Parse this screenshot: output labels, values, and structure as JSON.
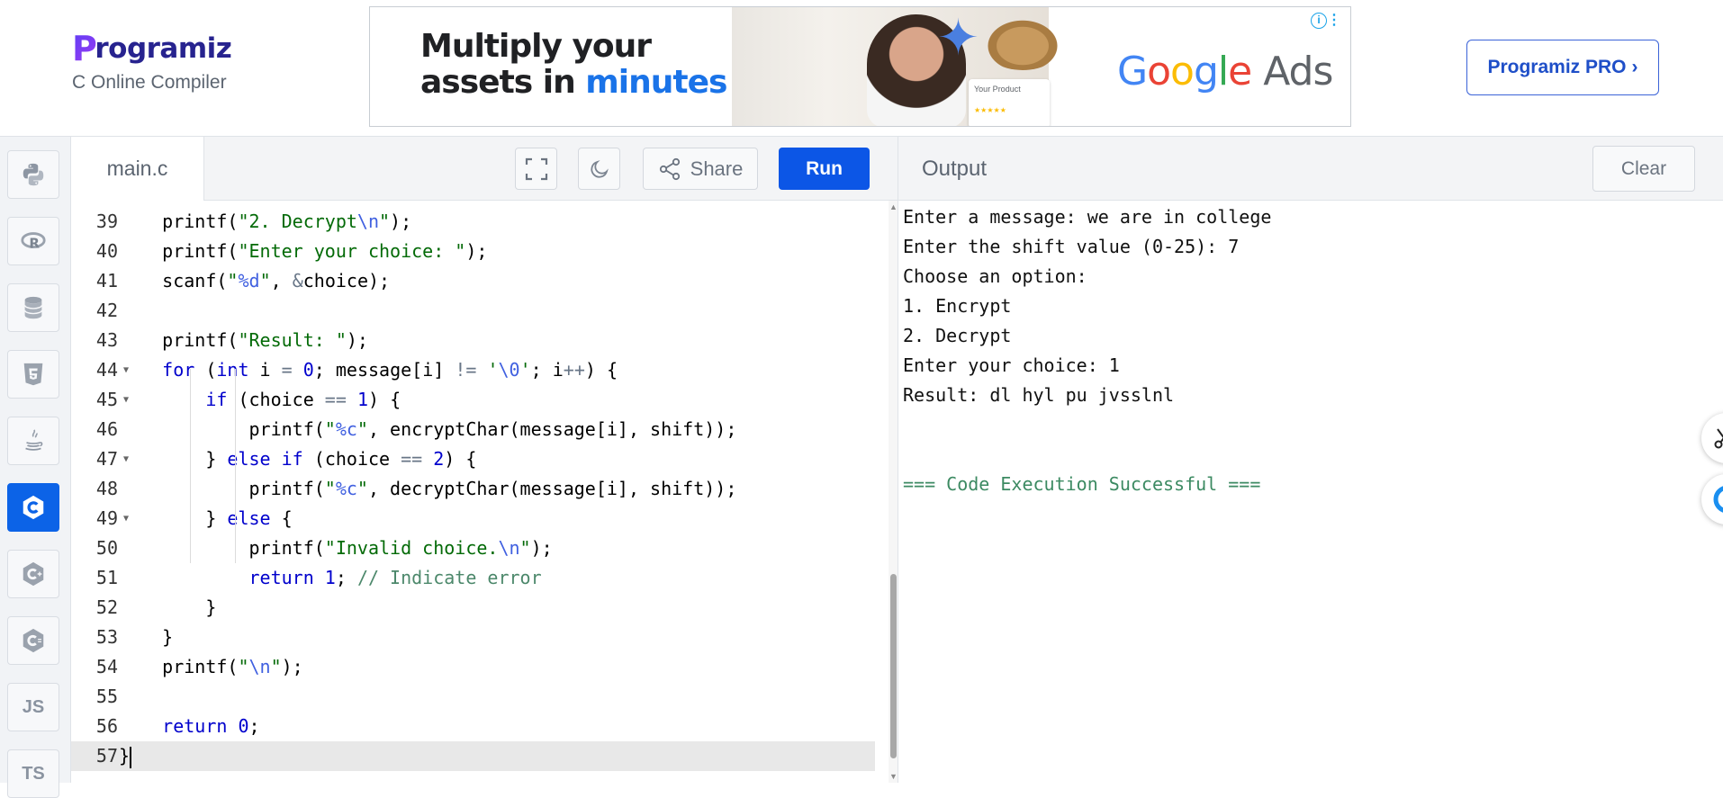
{
  "brand": {
    "name": "rogramiz",
    "subtitle": "C Online Compiler"
  },
  "ad": {
    "headline_line1": "Multiply your",
    "headline_line2_prefix": "assets in ",
    "headline_line2_highlight": "minutes",
    "product_card": "Your Product",
    "google": [
      "G",
      "o",
      "o",
      "g",
      "l",
      "e"
    ],
    "google_ads_word": "Ads",
    "info_icon": "info-icon"
  },
  "header": {
    "pro_button": "Programiz PRO",
    "pro_chevron": "›"
  },
  "sidebar": {
    "languages": [
      {
        "id": "python",
        "icon": "python-icon"
      },
      {
        "id": "r",
        "icon": "r-icon"
      },
      {
        "id": "sql",
        "icon": "database-icon"
      },
      {
        "id": "html",
        "icon": "html5-icon"
      },
      {
        "id": "java",
        "icon": "java-icon"
      },
      {
        "id": "c",
        "icon": "c-icon",
        "active": true
      },
      {
        "id": "cpp",
        "icon": "cpp-icon"
      },
      {
        "id": "csharp",
        "icon": "csharp-icon"
      },
      {
        "id": "js",
        "label": "JS"
      },
      {
        "id": "ts",
        "label": "TS"
      }
    ]
  },
  "editor": {
    "tab": "main.c",
    "share_label": "Share",
    "run_label": "Run",
    "lines": [
      {
        "n": 39,
        "text": "    printf(\"2. Decrypt\\n\");"
      },
      {
        "n": 40,
        "text": "    printf(\"Enter your choice: \");"
      },
      {
        "n": 41,
        "text": "    scanf(\"%d\", &choice);"
      },
      {
        "n": 42,
        "text": ""
      },
      {
        "n": 43,
        "text": "    printf(\"Result: \");"
      },
      {
        "n": 44,
        "text": "    for (int i = 0; message[i] != '\\0'; i++) {",
        "fold": true
      },
      {
        "n": 45,
        "text": "        if (choice == 1) {",
        "fold": true
      },
      {
        "n": 46,
        "text": "            printf(\"%c\", encryptChar(message[i], shift));"
      },
      {
        "n": 47,
        "text": "        } else if (choice == 2) {",
        "fold": true
      },
      {
        "n": 48,
        "text": "            printf(\"%c\", decryptChar(message[i], shift));"
      },
      {
        "n": 49,
        "text": "        } else {",
        "fold": true
      },
      {
        "n": 50,
        "text": "            printf(\"Invalid choice.\\n\");"
      },
      {
        "n": 51,
        "text": "            return 1; // Indicate error"
      },
      {
        "n": 52,
        "text": "        }"
      },
      {
        "n": 53,
        "text": "    }"
      },
      {
        "n": 54,
        "text": "    printf(\"\\n\");"
      },
      {
        "n": 55,
        "text": ""
      },
      {
        "n": 56,
        "text": "    return 0;"
      },
      {
        "n": 57,
        "text": "}",
        "active": true
      }
    ]
  },
  "output": {
    "title": "Output",
    "clear_label": "Clear",
    "lines": [
      "Enter a message: we are in college",
      "Enter the shift value (0-25): 7",
      "Choose an option:",
      "1. Encrypt",
      "2. Decrypt",
      "Enter your choice: 1",
      "Result: dl hyl pu jvsslnl",
      "",
      "",
      "=== Code Execution Successful ==="
    ]
  },
  "colors": {
    "accent": "#0c56e6",
    "brand": "#27238f",
    "success": "#3c8a62"
  }
}
